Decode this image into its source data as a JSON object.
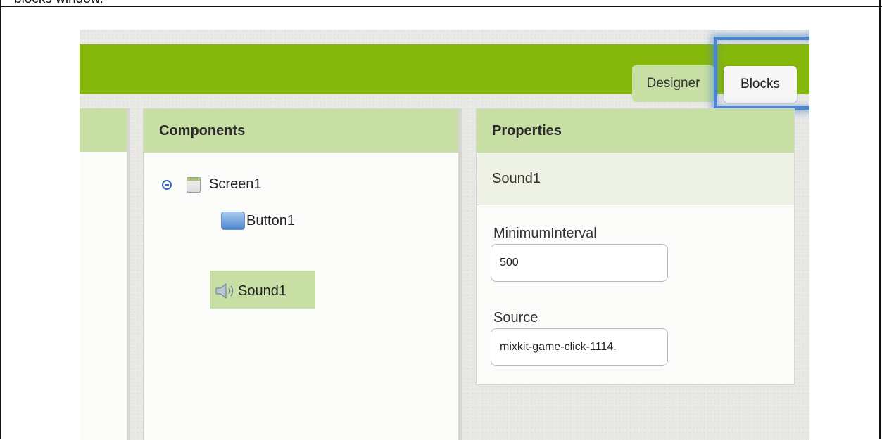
{
  "caption": "blocks window.",
  "toolbar": {
    "designer_label": "Designer",
    "blocks_label": "Blocks"
  },
  "components": {
    "title": "Components",
    "tree": [
      {
        "label": "Screen1",
        "icon": "screen-icon",
        "expanded": true
      },
      {
        "label": "Button1",
        "icon": "button-icon"
      },
      {
        "label": "Sound1",
        "icon": "speaker-icon",
        "selected": true
      }
    ]
  },
  "properties": {
    "title": "Properties",
    "selected_component": "Sound1",
    "fields": [
      {
        "label": "MinimumInterval",
        "value": "500"
      },
      {
        "label": "Source",
        "value": "mixkit-game-click-1114."
      }
    ]
  },
  "colors": {
    "toolbar_green": "#86b70b",
    "panel_header": "#c7dea4",
    "highlight_blue": "#4b86cf"
  }
}
